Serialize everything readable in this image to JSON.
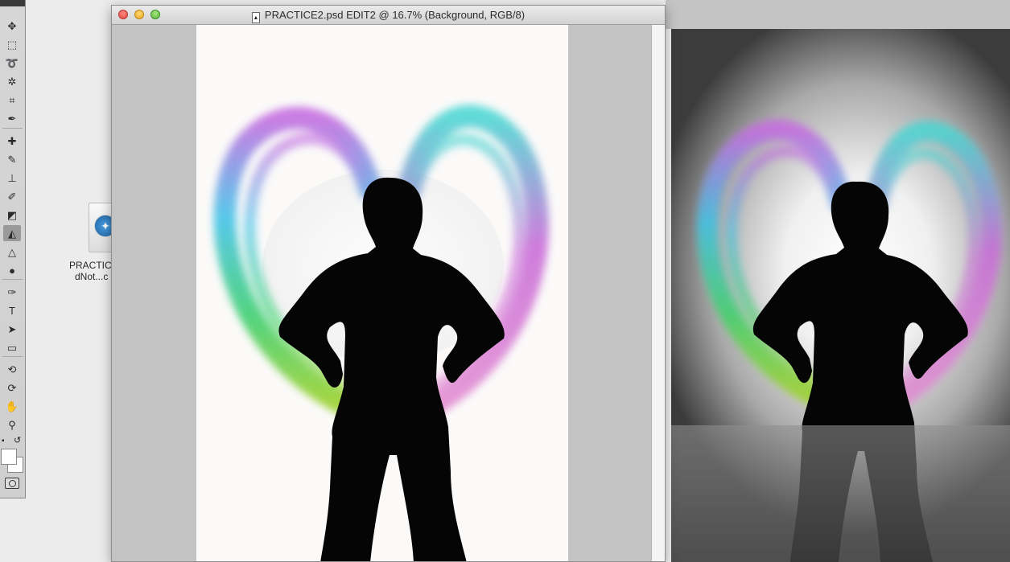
{
  "document": {
    "title": "PRACTICE2.psd EDIT2 @ 16.7% (Background, RGB/8)"
  },
  "desktop_file": {
    "label_line1": "PRACTIC",
    "label_line2": "dNot...c"
  },
  "tools": [
    {
      "name": "move-tool",
      "glyph": "✥"
    },
    {
      "name": "marquee-tool",
      "glyph": "⬚"
    },
    {
      "name": "lasso-tool",
      "glyph": "➰"
    },
    {
      "name": "magic-wand-tool",
      "glyph": "✲"
    },
    {
      "name": "crop-tool",
      "glyph": "⌗"
    },
    {
      "name": "eyedropper-tool",
      "glyph": "✒"
    },
    {
      "name": "healing-brush-tool",
      "glyph": "✚"
    },
    {
      "name": "brush-tool",
      "glyph": "✎"
    },
    {
      "name": "clone-stamp-tool",
      "glyph": "⊥"
    },
    {
      "name": "history-brush-tool",
      "glyph": "✐"
    },
    {
      "name": "eraser-tool",
      "glyph": "◩"
    },
    {
      "name": "paint-bucket-tool",
      "glyph": "◭"
    },
    {
      "name": "blur-tool",
      "glyph": "△"
    },
    {
      "name": "dodge-tool",
      "glyph": "●"
    },
    {
      "name": "pen-tool",
      "glyph": "✑"
    },
    {
      "name": "type-tool",
      "glyph": "T"
    },
    {
      "name": "path-selection-tool",
      "glyph": "➤"
    },
    {
      "name": "rectangle-tool",
      "glyph": "▭"
    },
    {
      "name": "3d-rotate-tool",
      "glyph": "⟲"
    },
    {
      "name": "3d-orbit-tool",
      "glyph": "⟳"
    },
    {
      "name": "hand-tool",
      "glyph": "✋"
    },
    {
      "name": "zoom-tool",
      "glyph": "⚲"
    }
  ],
  "active_tool": "paint-bucket-tool",
  "colors": {
    "foreground": "#ffffff",
    "background": "#ffffff"
  }
}
